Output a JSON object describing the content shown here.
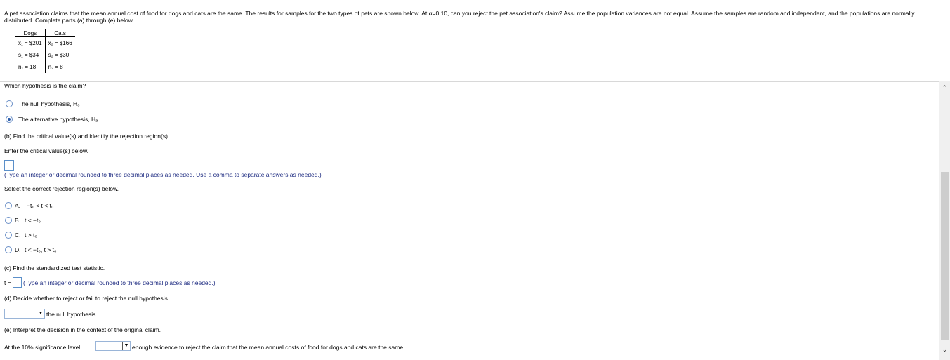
{
  "problem": "A pet association claims that the mean annual cost of food for dogs and cats are the same. The results for samples for the two types of pets are shown below. At α=0.10, can you reject the pet association's claim? Assume the population variances are not equal. Assume the samples are random and independent, and the populations are normally distributed. Complete parts (a) through (e) below.",
  "table": {
    "headers": [
      "Dogs",
      "Cats"
    ],
    "rows": [
      [
        "x̄₁ = $201",
        "x̄₂ = $166"
      ],
      [
        "s₁ = $34",
        "s₂ = $30"
      ],
      [
        "n₁ = 18",
        "n₂ = 8"
      ]
    ]
  },
  "a": {
    "question": "Which hypothesis is the claim?",
    "options": [
      "The null hypothesis, H₀",
      "The alternative hypothesis, Hₐ"
    ],
    "selected": 1
  },
  "b": {
    "question": "(b) Find the critical value(s) and identify the rejection region(s).",
    "prompt": "Enter the critical value(s) below.",
    "hint": "(Type an integer or decimal rounded to three decimal places as needed. Use a comma to separate answers as needed.)",
    "select_prompt": "Select the correct rejection region(s) below.",
    "options": [
      {
        "letter": "A.",
        "text": "−t₀ < t < t₀"
      },
      {
        "letter": "B.",
        "text": "t < −t₀"
      },
      {
        "letter": "C.",
        "text": "t > t₀"
      },
      {
        "letter": "D.",
        "text": "t < −t₀, t > t₀"
      }
    ]
  },
  "c": {
    "question": "(c) Find the standardized test statistic.",
    "label": "t =",
    "hint": "(Type an integer or decimal rounded to three decimal places as needed.)"
  },
  "d": {
    "question": "(d) Decide whether to reject or fail to reject the null hypothesis.",
    "dropdown_value": "",
    "suffix": "the null hypothesis."
  },
  "e": {
    "question": "(e) Interpret the decision in the context of the original claim.",
    "prefix": "At the 10% significance level,",
    "dropdown_value": "",
    "suffix": "enough evidence to reject the claim that the mean annual costs of food for dogs and cats are the same."
  },
  "icons": {
    "dropdown": "chevron-down-icon",
    "scroll_up": "scroll-up-icon",
    "scroll_down": "scroll-down-icon"
  }
}
